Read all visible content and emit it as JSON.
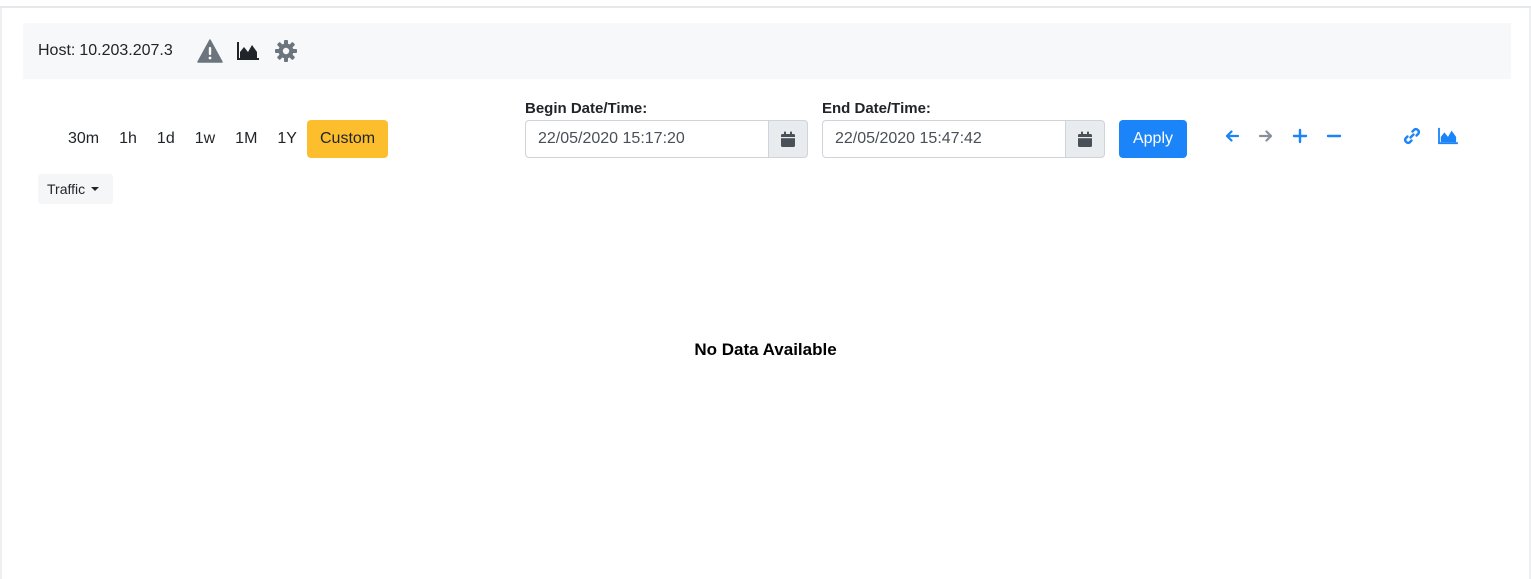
{
  "host": {
    "prefix": "Host:",
    "address": "10.203.207.3",
    "icons": [
      "warning-icon",
      "area-chart-icon",
      "gear-icon"
    ]
  },
  "ranges": {
    "items": [
      "30m",
      "1h",
      "1d",
      "1w",
      "1M",
      "1Y",
      "Custom"
    ],
    "active": "Custom"
  },
  "begin": {
    "label": "Begin Date/Time:",
    "value": "22/05/2020 15:17:20"
  },
  "end": {
    "label": "End Date/Time:",
    "value": "22/05/2020 15:47:42"
  },
  "apply_label": "Apply",
  "nav": {
    "icons": [
      "arrow-left-icon",
      "arrow-right-icon",
      "plus-icon",
      "minus-icon",
      "link-icon",
      "area-chart-icon"
    ]
  },
  "metric_dropdown": {
    "selected": "Traffic"
  },
  "empty_state": "No Data Available",
  "colors": {
    "accent": "#1a84f8",
    "active_range": "#fcbe2c",
    "icon_gray": "#6c757d",
    "host_bar_bg": "#f7f8fa"
  }
}
